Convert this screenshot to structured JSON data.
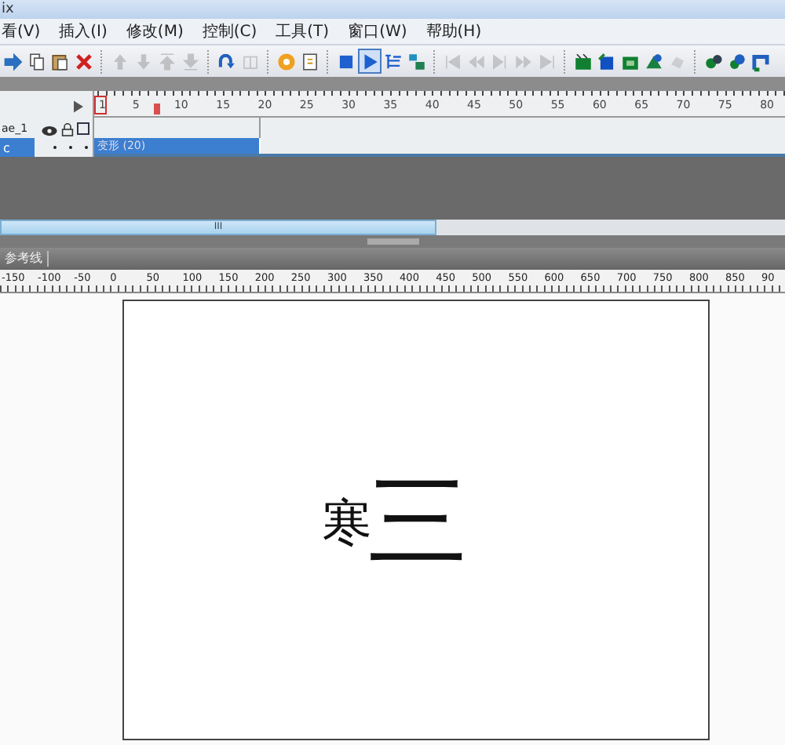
{
  "window": {
    "title": "ix"
  },
  "menu": [
    "看(V)",
    "插入(I)",
    "修改(M)",
    "控制(C)",
    "工具(T)",
    "窗口(W)",
    "帮助(H)"
  ],
  "toolbar": [
    {
      "buttons": [
        {
          "disabled": false,
          "selected": false
        },
        {
          "disabled": false,
          "selected": false
        },
        {
          "disabled": false,
          "selected": false
        },
        {
          "disabled": false,
          "selected": false
        }
      ]
    },
    {
      "buttons": [
        {
          "disabled": true,
          "selected": false
        },
        {
          "disabled": true,
          "selected": false
        },
        {
          "disabled": true,
          "selected": false
        },
        {
          "disabled": true,
          "selected": false
        }
      ]
    },
    {
      "buttons": [
        {
          "disabled": false,
          "selected": false
        },
        {
          "disabled": true,
          "selected": false
        }
      ]
    },
    {
      "buttons": [
        {
          "disabled": false,
          "selected": false
        },
        {
          "disabled": false,
          "selected": false
        }
      ]
    },
    {
      "buttons": [
        {
          "disabled": false,
          "selected": false
        },
        {
          "disabled": false,
          "selected": true
        },
        {
          "disabled": false,
          "selected": false
        },
        {
          "disabled": false,
          "selected": false
        }
      ]
    },
    {
      "buttons": [
        {
          "disabled": true,
          "selected": false
        },
        {
          "disabled": true,
          "selected": false
        },
        {
          "disabled": true,
          "selected": false
        },
        {
          "disabled": true,
          "selected": false
        },
        {
          "disabled": true,
          "selected": false
        }
      ]
    },
    {
      "buttons": [
        {
          "disabled": false,
          "selected": false
        },
        {
          "disabled": false,
          "selected": false
        },
        {
          "disabled": false,
          "selected": false
        },
        {
          "disabled": false,
          "selected": false
        },
        {
          "disabled": true,
          "selected": false
        }
      ]
    },
    {
      "buttons": [
        {
          "disabled": false,
          "selected": false
        },
        {
          "disabled": false,
          "selected": false
        },
        {
          "disabled": false,
          "selected": false
        }
      ]
    }
  ],
  "timeline": {
    "frame_numbers": [
      "1",
      "5",
      "10",
      "15",
      "20",
      "25",
      "30",
      "35",
      "40",
      "45",
      "50",
      "55",
      "60",
      "65",
      "70",
      "75",
      "80"
    ],
    "scene": "ae_1",
    "layers": [
      {
        "name": "c",
        "selected": true,
        "tween": "变形 (20)"
      }
    ]
  },
  "scrollbar": {
    "grip": "III"
  },
  "tab": {
    "label": "参考线"
  },
  "stage_ruler": [
    "-150",
    "-100",
    "-50",
    "0",
    "50",
    "100",
    "150",
    "200",
    "250",
    "300",
    "350",
    "400",
    "450",
    "500",
    "550",
    "600",
    "650",
    "700",
    "750",
    "800",
    "850",
    "90"
  ],
  "stage": {
    "texts": [
      {
        "kind": "small",
        "text": "寒"
      },
      {
        "kind": "large",
        "text": "三"
      }
    ]
  }
}
